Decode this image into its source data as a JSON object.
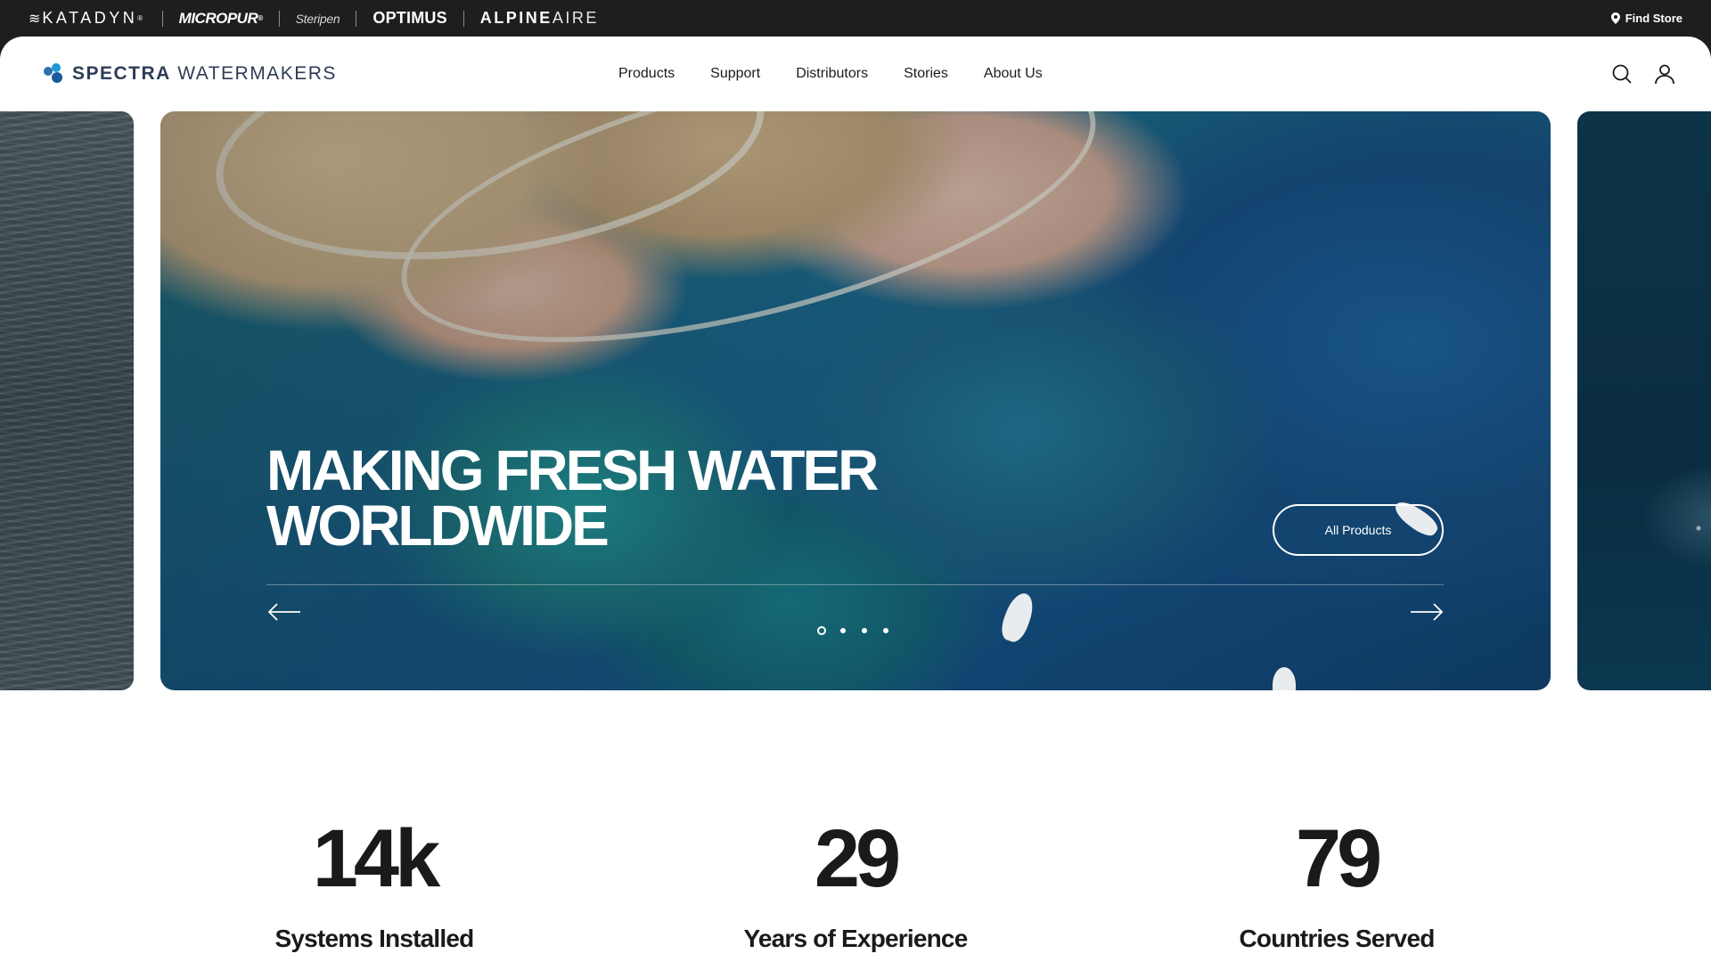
{
  "brandbar": {
    "brands": [
      {
        "name": "katadyn",
        "label": "KATADYN"
      },
      {
        "name": "micropur",
        "label": "MICROPUR"
      },
      {
        "name": "steripen",
        "label": "Steripen"
      },
      {
        "name": "optimus",
        "label": "OPTIMUS"
      },
      {
        "name": "alpineaire",
        "label_bold": "ALPINE",
        "label_light": "AIRE"
      }
    ],
    "find_store": "Find Store"
  },
  "header": {
    "logo_bold": "SPECTRA",
    "logo_light": "WATERMAKERS",
    "nav": [
      "Products",
      "Support",
      "Distributors",
      "Stories",
      "About Us"
    ],
    "icons": [
      "search-icon",
      "user-icon"
    ]
  },
  "hero": {
    "title_line1": "MAKING FRESH WATER",
    "title_line2": "WORLDWIDE",
    "cta": "All Products",
    "slide_count": 4,
    "active_slide": 1
  },
  "stats": [
    {
      "number": "14k",
      "label": "Systems Installed"
    },
    {
      "number": "29",
      "label": "Years of Experience"
    },
    {
      "number": "79",
      "label": "Countries Served"
    }
  ],
  "colors": {
    "brandbar_bg": "#1e1e1e",
    "logo_text": "#2d3d55",
    "logo_accent": "#1a9ad6",
    "text_dark": "#1a1a1a"
  }
}
